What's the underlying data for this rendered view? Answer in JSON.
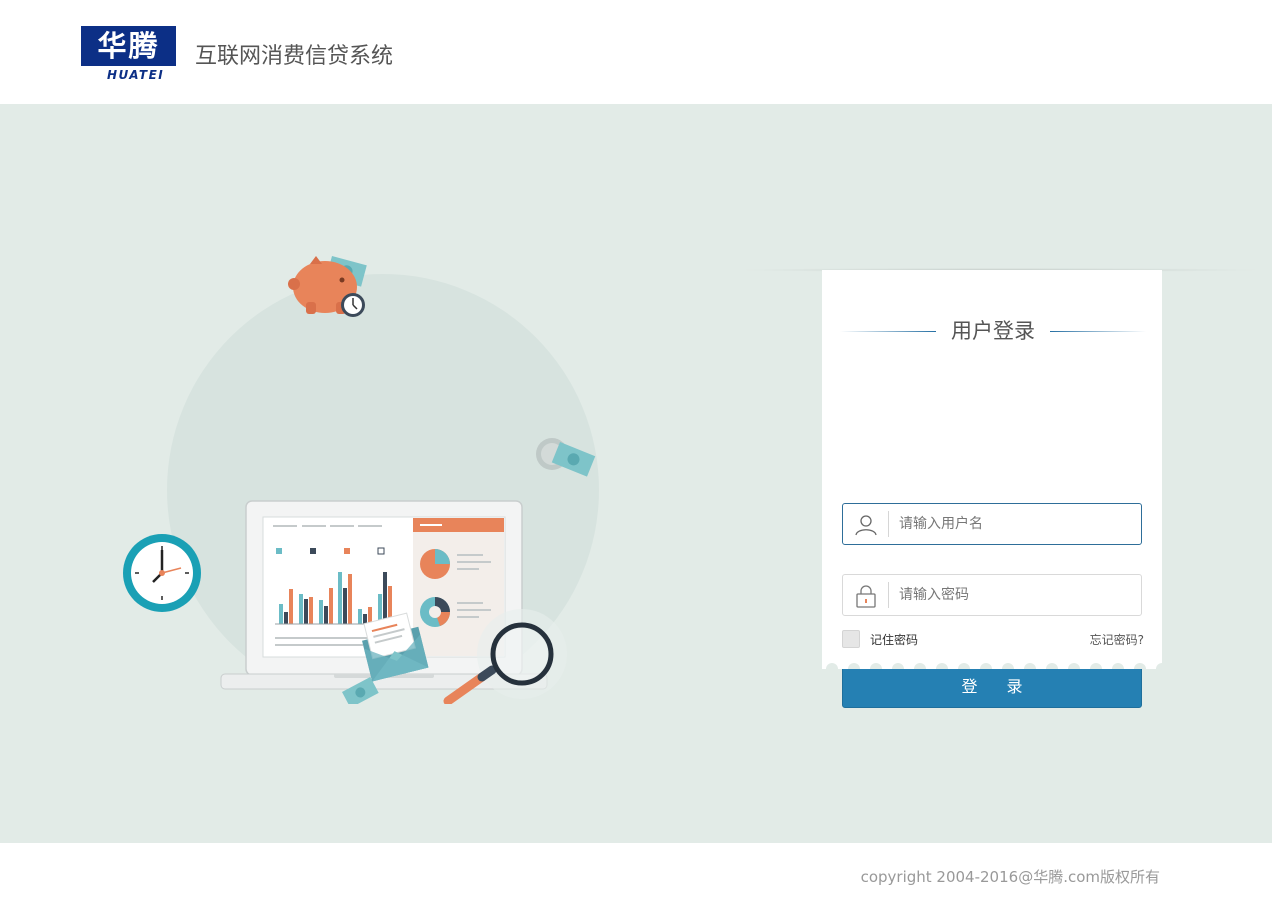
{
  "header": {
    "logo_text": "华腾",
    "logo_sub": "HUATEI",
    "system_title": "互联网消费信贷系统"
  },
  "login": {
    "title": "用户登录",
    "username_placeholder": "请输入用户名",
    "password_placeholder": "请输入密码",
    "remember_label": "记住密码",
    "forgot_label": "忘记密码?",
    "submit_label": "登 录"
  },
  "footer": {
    "copyright": "copyright 2004-2016@华腾.com版权所有"
  },
  "colors": {
    "brand_navy": "#0c2f86",
    "accent_blue": "#2580b3",
    "background": "#e2ebe7",
    "orange": "#e8845a",
    "teal": "#6bbcc6"
  },
  "icons": [
    "user-icon",
    "lock-icon",
    "clock-icon",
    "piggy-bank-icon",
    "money-icon",
    "laptop-icon",
    "magnifier-icon",
    "envelope-icon"
  ]
}
